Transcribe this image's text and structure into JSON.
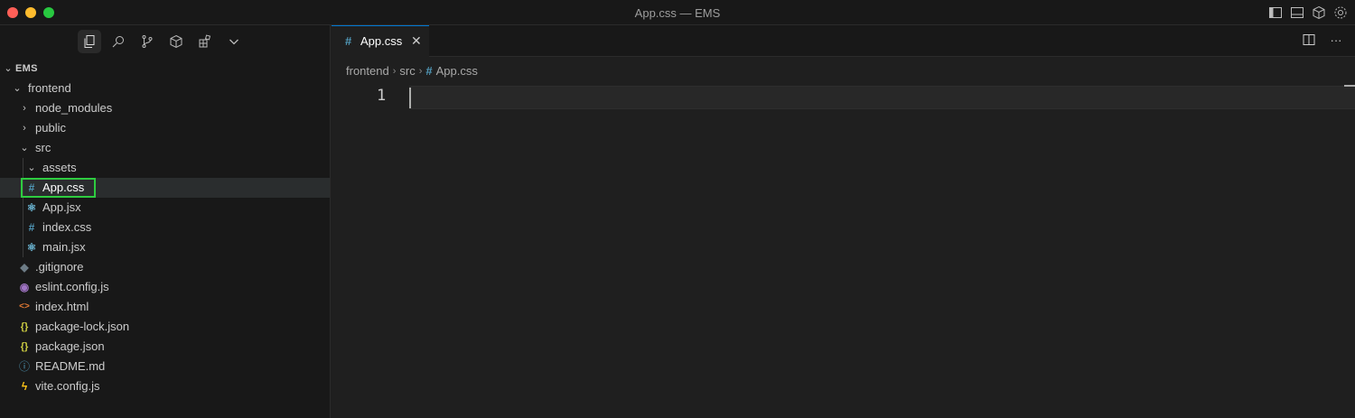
{
  "window": {
    "title": "App.css — EMS",
    "traffic_lights": [
      "close",
      "minimize",
      "zoom"
    ],
    "title_icons": [
      "toggle-sidebar-icon",
      "toggle-panel-icon",
      "extensions-cube-icon",
      "gear-icon"
    ]
  },
  "activity": {
    "items": [
      "explorer-icon",
      "search-icon",
      "source-control-icon",
      "run-debug-icon",
      "extensions-icon",
      "chevron-down-icon"
    ]
  },
  "explorer": {
    "root": "EMS",
    "frontend": "frontend",
    "node_modules": "node_modules",
    "public": "public",
    "src": "src",
    "assets": "assets",
    "app_css": "App.css",
    "app_jsx": "App.jsx",
    "index_css": "index.css",
    "main_jsx": "main.jsx",
    "gitignore": ".gitignore",
    "eslint": "eslint.config.js",
    "index_html": "index.html",
    "package_lock": "package-lock.json",
    "package_json": "package.json",
    "readme": "README.md",
    "vite": "vite.config.js"
  },
  "editor": {
    "tab_label": "App.css",
    "tab_icon": "#",
    "breadcrumb": [
      "frontend",
      "src",
      "App.css"
    ],
    "line_number": "1"
  },
  "colors": {
    "accent": "#0078d4",
    "css_icon": "#519aba",
    "highlight": "#2ecc40"
  }
}
